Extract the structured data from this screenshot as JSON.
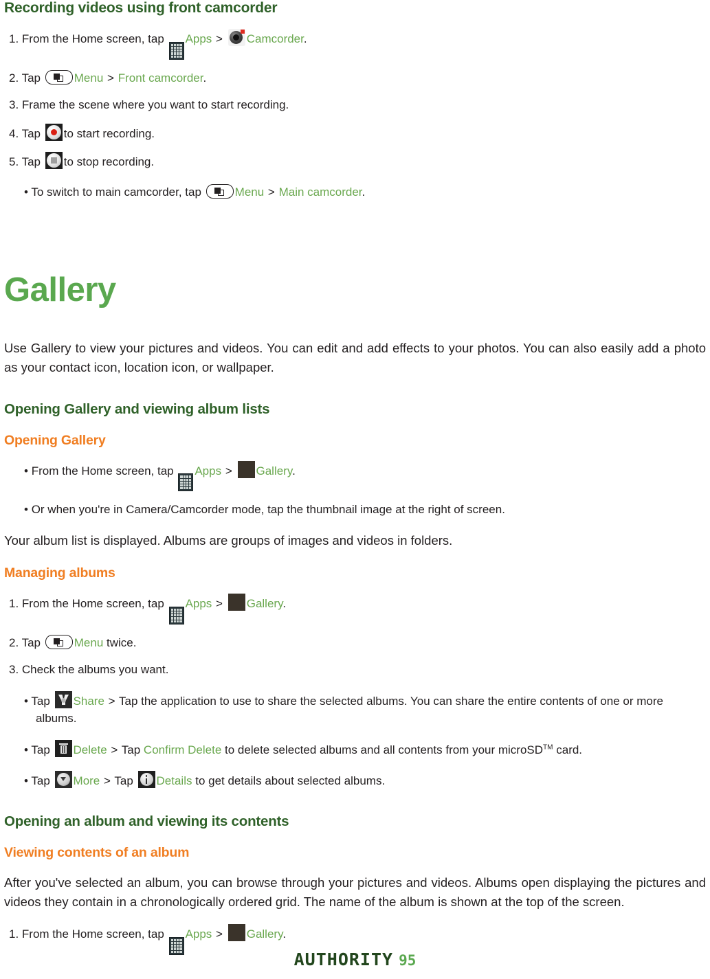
{
  "sections": {
    "front_camcorder": {
      "heading": "Recording videos using front camcorder",
      "steps": {
        "s1_a": "1. From the Home screen, tap",
        "s1_apps": "Apps",
        "s1_gt": ">",
        "s1_camcorder": "Camcorder",
        "s1_end": ".",
        "s2_a": "2. Tap",
        "s2_menu": "Menu",
        "s2_gt": ">",
        "s2_front": "Front camcorder",
        "s2_end": ".",
        "s3": "3. Frame the scene where you want to start recording.",
        "s4_a": "4. Tap",
        "s4_b": "to start recording.",
        "s5_a": "5. Tap",
        "s5_b": "to stop recording.",
        "note_bullet": "•",
        "note_a": "To switch to main camcorder, tap",
        "note_menu": "Menu",
        "note_gt": ">",
        "note_main": "Main camcorder",
        "note_end": "."
      }
    },
    "gallery": {
      "title": "Gallery",
      "intro": "Use Gallery to view your pictures and videos. You can edit and add effects to your photos. You can also easily add a photo as your contact icon, location icon, or wallpaper.",
      "opening_section": "Opening Gallery and viewing album lists",
      "opening_sub": "Opening Gallery",
      "b1_bullet": "•",
      "b1_a": "From the Home screen, tap",
      "b1_apps": "Apps",
      "b1_gt": ">",
      "b1_gallery": "Gallery",
      "b1_end": ".",
      "b2_bullet": "•",
      "b2": "Or when you're in Camera/Camcorder mode, tap the thumbnail image at the right of screen.",
      "album_note": "Your album list is displayed. Albums are groups of images and videos in folders.",
      "managing_sub": "Managing albums",
      "m1_a": "1. From the Home screen, tap",
      "m1_apps": "Apps",
      "m1_gt": ">",
      "m1_gallery": "Gallery",
      "m1_end": ".",
      "m2_a": "2. Tap",
      "m2_menu": "Menu",
      "m2_b": "twice.",
      "m3": "3. Check the albums you want.",
      "share_bullet": "•",
      "share_tap": "Tap",
      "share_label": "Share",
      "share_gt": ">",
      "share_rest": "Tap the application to use to share the selected albums. You can share the entire contents of one or more albums.",
      "delete_bullet": "•",
      "delete_tap": "Tap",
      "delete_label": "Delete",
      "delete_gt": ">",
      "delete_tap2": "Tap",
      "delete_confirm": "Confirm Delete",
      "delete_rest_a": "to delete selected albums and all contents from your microSD",
      "delete_tm": "TM",
      "delete_rest_b": "card.",
      "more_bullet": "•",
      "more_tap": "Tap",
      "more_label": "More",
      "more_gt": ">",
      "more_tap2": "Tap",
      "details_label": "Details",
      "more_rest": "to get details about selected albums.",
      "opening_album_section": "Opening an album and viewing its contents",
      "viewing_sub": "Viewing contents of an album",
      "viewing_para": "After you've selected an album, you can browse through your pictures and videos. Albums open displaying the pictures and videos they contain in a chronologically ordered grid. The name of the album is shown at the top of the screen.",
      "v1_a": "1. From the Home screen, tap",
      "v1_apps": "Apps",
      "v1_gt": ">",
      "v1_gallery": "Gallery",
      "v1_end": "."
    }
  },
  "footer": {
    "brand": "AUTHORITY",
    "page_number": "95"
  },
  "icons": {
    "apps": "apps-grid-icon",
    "camcorder": "camcorder-lens-icon",
    "menu_key": "menu-hardware-key-icon",
    "record": "record-button-icon",
    "stop": "stop-button-icon",
    "gallery": "gallery-sunset-icon",
    "share": "share-icon",
    "delete": "trash-icon",
    "more": "more-chevron-icon",
    "details": "info-icon"
  },
  "colors": {
    "heading_dark_green": "#2f6129",
    "title_green": "#5aa84f",
    "link_green": "#6aa84f",
    "sub_orange": "#f07e22",
    "body_black": "#231f20"
  }
}
